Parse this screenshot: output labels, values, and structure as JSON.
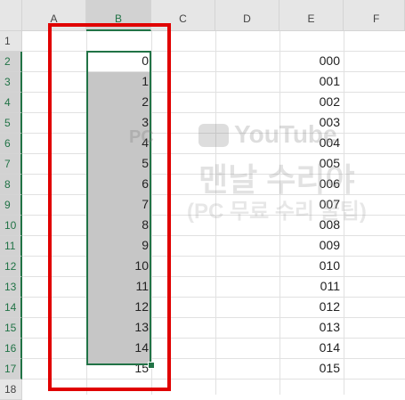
{
  "columns": [
    "A",
    "B",
    "C",
    "D",
    "E",
    "F"
  ],
  "rows": [
    "1",
    "2",
    "3",
    "4",
    "5",
    "6",
    "7",
    "8",
    "9",
    "10",
    "11",
    "12",
    "13",
    "14",
    "15",
    "16",
    "17",
    "18"
  ],
  "colB": [
    "0",
    "1",
    "2",
    "3",
    "4",
    "5",
    "6",
    "7",
    "8",
    "9",
    "10",
    "11",
    "12",
    "13",
    "14",
    "15"
  ],
  "colE": [
    "000",
    "001",
    "002",
    "003",
    "004",
    "005",
    "006",
    "007",
    "008",
    "009",
    "010",
    "011",
    "012",
    "013",
    "014",
    "015"
  ],
  "watermark": {
    "youtube": "YouTube",
    "line1": "맨날 수리야",
    "line2": "(PC 무료 수리 꿀팁)",
    "pc": "PC"
  },
  "colors": {
    "selection": "#217346",
    "highlight": "#e00000",
    "shade": "#c6c6c6"
  }
}
